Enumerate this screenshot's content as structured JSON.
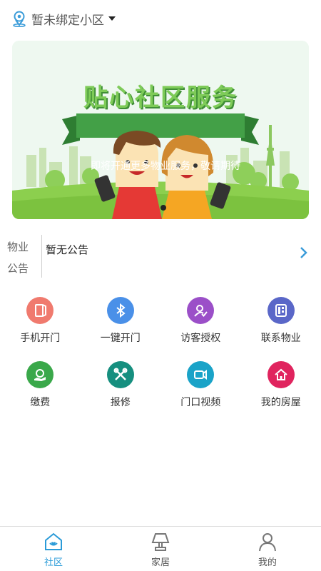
{
  "header": {
    "community_label": "暂未绑定小区",
    "location_icon": "location-pin-icon",
    "dropdown_icon": "caret-down-icon"
  },
  "banner": {
    "title": "贴心社区服务",
    "subtitle": "即将开通更多物业服务，敬请期待"
  },
  "notice": {
    "label_line1": "物业",
    "label_line2": "公告",
    "text": "暂无公告"
  },
  "services": [
    {
      "label": "手机开门",
      "icon": "phone-door-icon",
      "color": "#f07a6e"
    },
    {
      "label": "一键开门",
      "icon": "bluetooth-icon",
      "color": "#4a90e8"
    },
    {
      "label": "访客授权",
      "icon": "visitor-auth-icon",
      "color": "#9b4fc8"
    },
    {
      "label": "联系物业",
      "icon": "phone-contact-icon",
      "color": "#5a67c8"
    },
    {
      "label": "缴费",
      "icon": "payment-icon",
      "color": "#3aa84a"
    },
    {
      "label": "报修",
      "icon": "repair-tools-icon",
      "color": "#168f7f"
    },
    {
      "label": "门口视频",
      "icon": "video-camera-icon",
      "color": "#1aa3c8"
    },
    {
      "label": "我的房屋",
      "icon": "house-icon",
      "color": "#e0245e"
    }
  ],
  "bottom_nav": {
    "items": [
      {
        "label": "社区",
        "icon": "community-home-icon",
        "active": true
      },
      {
        "label": "家居",
        "icon": "lamp-icon",
        "active": false
      },
      {
        "label": "我的",
        "icon": "profile-icon",
        "active": false
      }
    ],
    "active_color": "#2b9bd8"
  }
}
